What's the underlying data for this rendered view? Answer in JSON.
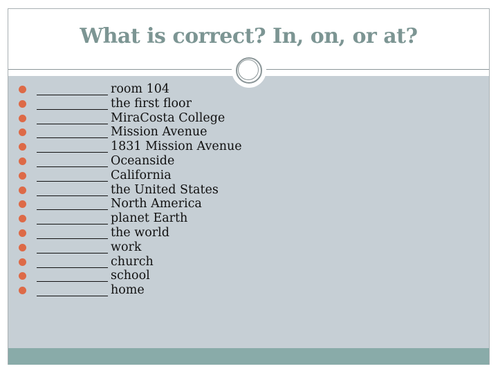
{
  "slide": {
    "title": "What is correct? In, on, or at?",
    "colors": {
      "title": "#7c9593",
      "content_background": "#c6cfd5",
      "footer_band": "#89aba9",
      "bullet": "#dd6a47"
    },
    "items": [
      {
        "blank": "________",
        "text": "room 104"
      },
      {
        "blank": "________",
        "text": "the first floor"
      },
      {
        "blank": "________",
        "text": "MiraCosta College"
      },
      {
        "blank": "________",
        "text": "Mission Avenue"
      },
      {
        "blank": "________",
        "text": "1831 Mission Avenue"
      },
      {
        "blank": "________",
        "text": "Oceanside"
      },
      {
        "blank": "________",
        "text": "California"
      },
      {
        "blank": "________",
        "text": "the United States"
      },
      {
        "blank": "________",
        "text": "North America"
      },
      {
        "blank": "________",
        "text": "planet Earth"
      },
      {
        "blank": "________",
        "text": "the world"
      },
      {
        "blank": "________",
        "text": "work"
      },
      {
        "blank": "________",
        "text": "church"
      },
      {
        "blank": "________",
        "text": "school"
      },
      {
        "blank": "________",
        "text": "home"
      }
    ]
  }
}
